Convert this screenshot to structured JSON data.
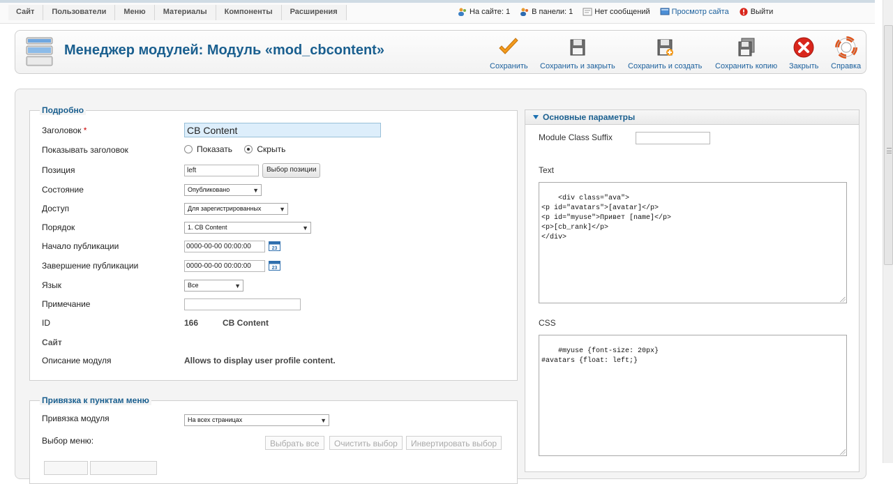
{
  "top_menu": [
    "Сайт",
    "Пользователи",
    "Меню",
    "Материалы",
    "Компоненты",
    "Расширения"
  ],
  "status": {
    "on_site": "На сайте: 1",
    "in_panel": "В панели: 1",
    "messages": "Нет сообщений",
    "view_site": "Просмотр сайта",
    "logout": "Выйти"
  },
  "page_title": "Менеджер модулей: Модуль «mod_cbcontent»",
  "toolbar": {
    "save": "Сохранить",
    "save_close": "Сохранить и закрыть",
    "save_new": "Сохранить и создать",
    "save_copy": "Сохранить копию",
    "close": "Закрыть",
    "help": "Справка"
  },
  "details": {
    "legend": "Подробно",
    "title_label": "Заголовок",
    "required_mark": "*",
    "title_value": "CB Content",
    "show_title_label": "Показывать заголовок",
    "show_option": "Показать",
    "hide_option": "Скрыть",
    "show_title_selected": "Скрыть",
    "position_label": "Позиция",
    "position_value": "left",
    "position_button": "Выбор позиции",
    "state_label": "Состояние",
    "state_value": "Опубликовано",
    "access_label": "Доступ",
    "access_value": "Для зарегистрированных",
    "ordering_label": "Порядок",
    "ordering_value": "1. CB Content",
    "publish_up_label": "Начало публикации",
    "publish_up_value": "0000-00-00 00:00:00",
    "publish_down_label": "Завершение публикации",
    "publish_down_value": "0000-00-00 00:00:00",
    "calendar_day": "23",
    "language_label": "Язык",
    "language_value": "Все",
    "note_label": "Примечание",
    "note_value": "",
    "id_label": "ID",
    "id_value": "166",
    "id_name": "CB Content",
    "site_label": "Сайт",
    "description_label": "Описание модуля",
    "description_value": "Allows to display user profile content."
  },
  "menu_assignment": {
    "legend": "Привязка к пунктам меню",
    "module_label": "Привязка модуля",
    "module_value": "На всех страницах",
    "menu_select_label": "Выбор меню:",
    "select_all": "Выбрать все",
    "clear_selection": "Очистить выбор",
    "invert_selection": "Инвертировать выбор"
  },
  "basic_options": {
    "header": "Основные параметры",
    "class_suffix_label": "Module Class Suffix",
    "class_suffix_value": "",
    "text_label": "Text",
    "text_value": "<div class=\"ava\">\n<p id=\"avatars\">[avatar]</p>\n<p id=\"myuse\">Привет [name]</p>\n<p>[cb_rank]</p>\n</div>",
    "css_label": "CSS",
    "css_value": "#myuse {font-size: 20px}\n#avatars {float: left;}"
  },
  "icons": {
    "save": "check-icon",
    "save_close": "floppy-icon",
    "save_new": "floppy-plus-icon",
    "save_copy": "floppy-copy-icon",
    "close": "close-circle-icon",
    "help": "lifebuoy-icon"
  },
  "colors": {
    "title": "#1a5f8f",
    "link": "#1a5f9c",
    "close_red": "#d9261c",
    "check_orange": "#f39a1c"
  }
}
